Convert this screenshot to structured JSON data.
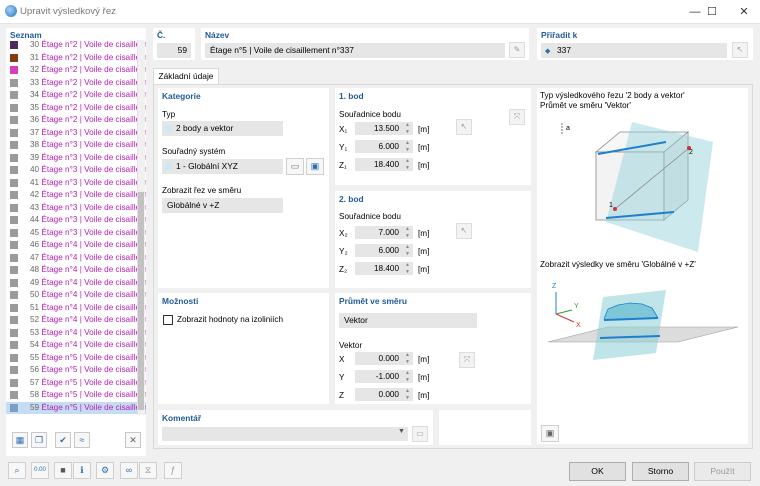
{
  "window": {
    "title": "Upravit výsledkový řez",
    "minimize": "—",
    "maximize": "☐",
    "close": "✕"
  },
  "list": {
    "header": "Seznam",
    "items": [
      {
        "num": "30",
        "name": "Étage n°2 | Voile de cisaillem",
        "color": "#4a2c5e"
      },
      {
        "num": "31",
        "name": "Étage n°2 | Voile de cisaillem",
        "color": "#8a3a10"
      },
      {
        "num": "32",
        "name": "Étage n°2 | Voile de cisaillem",
        "color": "#d63ec0"
      },
      {
        "num": "33",
        "name": "Étage n°2 | Voile de cisaillem",
        "color": "#9a9a9a"
      },
      {
        "num": "34",
        "name": "Étage n°2 | Voile de cisaillem",
        "color": "#9a9a9a"
      },
      {
        "num": "35",
        "name": "Étage n°2 | Voile de cisaillem",
        "color": "#9a9a9a"
      },
      {
        "num": "36",
        "name": "Étage n°2 | Voile de cisaillem",
        "color": "#9a9a9a"
      },
      {
        "num": "37",
        "name": "Étage n°3 | Voile de cisaillem",
        "color": "#9a9a9a"
      },
      {
        "num": "38",
        "name": "Étage n°3 | Voile de cisaillem",
        "color": "#9a9a9a"
      },
      {
        "num": "39",
        "name": "Étage n°3 | Voile de cisaillem",
        "color": "#9a9a9a"
      },
      {
        "num": "40",
        "name": "Étage n°3 | Voile de cisaillem",
        "color": "#9a9a9a"
      },
      {
        "num": "41",
        "name": "Étage n°3 | Voile de cisaillem",
        "color": "#9a9a9a"
      },
      {
        "num": "42",
        "name": "Étage n°3 | Voile de cisaillem",
        "color": "#9a9a9a"
      },
      {
        "num": "43",
        "name": "Étage n°3 | Voile de cisaillem",
        "color": "#9a9a9a"
      },
      {
        "num": "44",
        "name": "Étage n°3 | Voile de cisaillem",
        "color": "#9a9a9a"
      },
      {
        "num": "45",
        "name": "Étage n°3 | Voile de cisaillem",
        "color": "#9a9a9a"
      },
      {
        "num": "46",
        "name": "Étage n°4 | Voile de cisaillem",
        "color": "#9a9a9a"
      },
      {
        "num": "47",
        "name": "Étage n°4 | Voile de cisaillem",
        "color": "#9a9a9a"
      },
      {
        "num": "48",
        "name": "Étage n°4 | Voile de cisaillem",
        "color": "#9a9a9a"
      },
      {
        "num": "49",
        "name": "Étage n°4 | Voile de cisaillem",
        "color": "#9a9a9a"
      },
      {
        "num": "50",
        "name": "Étage n°4 | Voile de cisaillem",
        "color": "#9a9a9a"
      },
      {
        "num": "51",
        "name": "Étage n°4 | Voile de cisaillem",
        "color": "#9a9a9a"
      },
      {
        "num": "52",
        "name": "Étage n°4 | Voile de cisaillem",
        "color": "#9a9a9a"
      },
      {
        "num": "53",
        "name": "Étage n°4 | Voile de cisaillem",
        "color": "#9a9a9a"
      },
      {
        "num": "54",
        "name": "Étage n°4 | Voile de cisaillem",
        "color": "#9a9a9a"
      },
      {
        "num": "55",
        "name": "Étage n°5 | Voile de cisaillem",
        "color": "#9a9a9a"
      },
      {
        "num": "56",
        "name": "Étage n°5 | Voile de cisaillem",
        "color": "#9a9a9a"
      },
      {
        "num": "57",
        "name": "Étage n°5 | Voile de cisaillem",
        "color": "#9a9a9a"
      },
      {
        "num": "58",
        "name": "Étage n°5 | Voile de cisaillem",
        "color": "#9a9a9a"
      },
      {
        "num": "59",
        "name": "Étage n°5 | Voile de cisaillem",
        "color": "#7a9ec4",
        "selected": true
      }
    ]
  },
  "header": {
    "num_label": "Č.",
    "num_value": "59",
    "name_label": "Název",
    "name_value": "Étage n°5 | Voile de cisaillement n°337",
    "assign_label": "Přiřadit k",
    "assign_value": "337"
  },
  "tab": "Základní údaje",
  "kategorie": {
    "title": "Kategorie",
    "typ_label": "Typ",
    "typ_value": "2 body a vektor",
    "sys_label": "Souřadný systém",
    "sys_value": "1 - Globální XYZ",
    "dir_label": "Zobrazit řez ve směru",
    "dir_value": "Globálné v +Z"
  },
  "bod1": {
    "title": "1. bod",
    "sub": "Souřadnice bodu",
    "x_label": "X₁",
    "x": "13.500",
    "y_label": "Y₁",
    "y": "6.000",
    "z_label": "Z₁",
    "z": "18.400",
    "unit": "[m]"
  },
  "bod2": {
    "title": "2. bod",
    "sub": "Souřadnice bodu",
    "x_label": "X₂",
    "x": "7.000",
    "y_label": "Y₂",
    "y": "6.000",
    "z_label": "Z₂",
    "z": "18.400",
    "unit": "[m]"
  },
  "moznosti": {
    "title": "Možnosti",
    "check_label": "Zobrazit hodnoty na izoliniích"
  },
  "prumet": {
    "title": "Průmět ve směru",
    "value": "Vektor",
    "vektor_label": "Vektor",
    "x_label": "X",
    "x": "0.000",
    "y_label": "Y",
    "y": "-1.000",
    "z_label": "Z",
    "z": "0.000",
    "unit": "[m]"
  },
  "komentar": {
    "title": "Komentář"
  },
  "preview": {
    "line1": "Typ výsledkového řezu '2 body a vektor'",
    "line2": "Průmět ve směru 'Vektor'",
    "line3": "Zobrazit výsledky ve směru 'Globálné v +Z'",
    "a_label": "a",
    "p1": "1",
    "p2": "2",
    "axis_x": "X",
    "axis_y": "Y",
    "axis_z": "Z"
  },
  "buttons": {
    "ok": "OK",
    "storno": "Storno",
    "pouzit": "Použít"
  }
}
